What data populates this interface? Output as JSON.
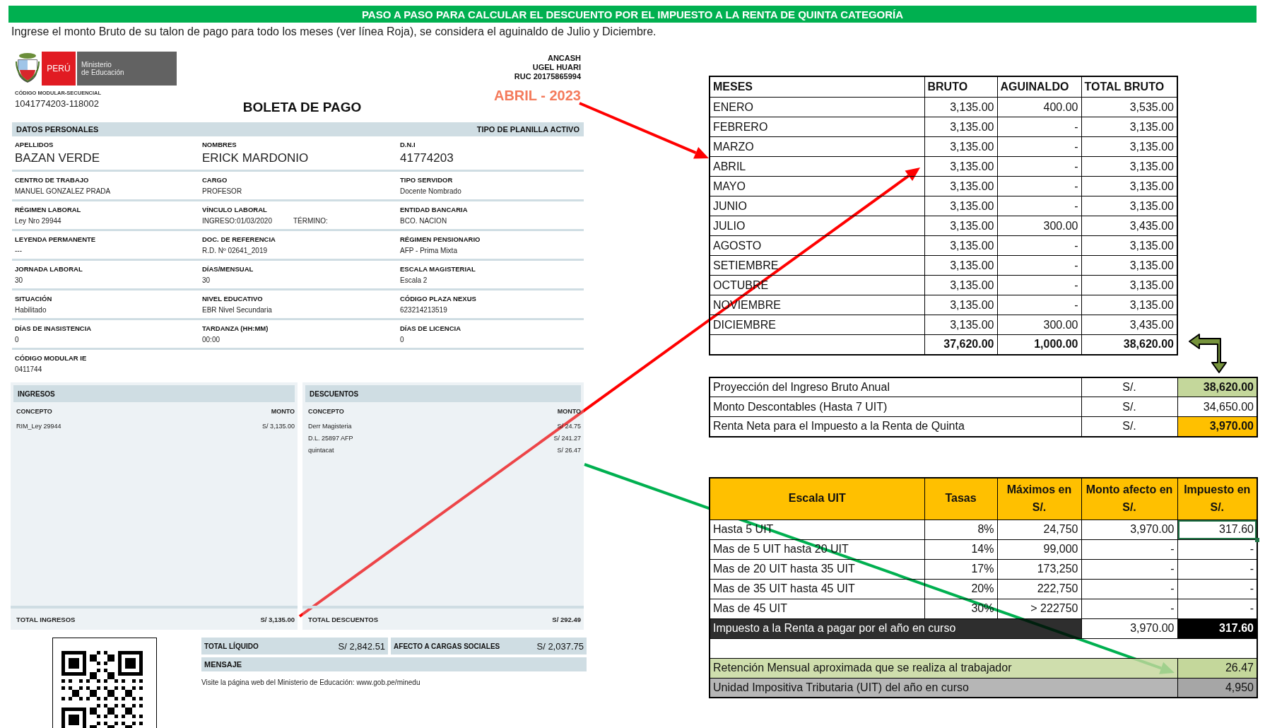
{
  "banner": "PASO A PASO PARA CALCULAR EL DESCUENTO POR EL IMPUESTO A LA RENTA DE QUINTA CATEGORÍA",
  "instruction": "Ingrese el monto Bruto de su talon de pago para todo los meses (ver línea Roja), se considera el aguinaldo de Julio y Diciembre.",
  "payslip": {
    "logo": {
      "country": "PERÚ",
      "ministry": [
        "Ministerio",
        "de Educación"
      ]
    },
    "code_label": "CÓDIGO MODULAR-SECUENCIAL",
    "code": "1041774203-118002",
    "title": "BOLETA DE PAGO",
    "issuer": [
      "ANCASH",
      "UGEL HUARI",
      "RUC 20175865994"
    ],
    "period": "ABRIL - 2023",
    "section": {
      "title": "DATOS PERSONALES",
      "right": "TIPO DE PLANILLA  ACTIVO"
    },
    "field_rows": [
      {
        "kind": "large",
        "fields": [
          {
            "label": "APELLIDOS",
            "value": "BAZAN VERDE"
          },
          {
            "label": "NOMBRES",
            "value": "ERICK MARDONIO"
          },
          {
            "label": "D.N.I",
            "value": "41774203"
          }
        ]
      },
      {
        "kind": "normal",
        "fields": [
          {
            "label": "CENTRO DE TRABAJO",
            "value": "MANUEL GONZALEZ PRADA"
          },
          {
            "label": "CARGO",
            "value": "PROFESOR"
          },
          {
            "label": "TIPO SERVIDOR",
            "value": "Docente Nombrado"
          }
        ]
      },
      {
        "kind": "normal",
        "fields": [
          {
            "label": "RÉGIMEN LABORAL",
            "value": "Ley Nro 29944"
          },
          {
            "label": "VÍNCULO LABORAL",
            "value": "INGRESO:01/03/2020",
            "extra": "TÉRMINO:"
          },
          {
            "label": "ENTIDAD BANCARIA",
            "value": "BCO. NACION"
          }
        ]
      },
      {
        "kind": "normal",
        "fields": [
          {
            "label": "LEYENDA PERMANENTE",
            "value": "---"
          },
          {
            "label": "DOC. DE REFERENCIA",
            "value": "R.D. Nº 02641_2019"
          },
          {
            "label": "RÉGIMEN PENSIONARIO",
            "value": "AFP - Prima Mixta"
          }
        ]
      },
      {
        "kind": "normal",
        "fields": [
          {
            "label": "JORNADA LABORAL",
            "value": "30"
          },
          {
            "label": "DÍAS/MENSUAL",
            "value": "30"
          },
          {
            "label": "ESCALA MAGISTERIAL",
            "value": "Escala 2"
          }
        ]
      },
      {
        "kind": "normal",
        "fields": [
          {
            "label": "SITUACIÓN",
            "value": "Habilitado"
          },
          {
            "label": "NIVEL EDUCATIVO",
            "value": "EBR Nivel Secundaria"
          },
          {
            "label": "CÓDIGO PLAZA NEXUS",
            "value": "623214213519"
          }
        ]
      },
      {
        "kind": "normal",
        "fields": [
          {
            "label": "DÍAS DE INASISTENCIA",
            "value": "0"
          },
          {
            "label": "TARDANZA  (HH:MM)",
            "value": "00:00"
          },
          {
            "label": "DÍAS DE LICENCIA",
            "value": "0"
          }
        ]
      },
      {
        "kind": "last",
        "fields": [
          {
            "label": "CÓDIGO MODULAR IE",
            "value": "0411744"
          }
        ]
      }
    ],
    "income": {
      "title": "INGRESOS",
      "columns": [
        "CONCEPTO",
        "MONTO"
      ],
      "rows": [
        [
          "RIM_Ley 29944",
          "S/ 3,135.00"
        ]
      ],
      "total_label": "TOTAL INGRESOS",
      "total": "S/ 3,135.00"
    },
    "deductions": {
      "title": "DESCUENTOS",
      "columns": [
        "CONCEPTO",
        "MONTO"
      ],
      "rows": [
        [
          "Derr Magisteria",
          "S/ 24.75"
        ],
        [
          "D.L. 25897 AFP",
          "S/ 241.27"
        ],
        [
          "quintacat",
          "S/ 26.47"
        ]
      ],
      "total_label": "TOTAL DESCUENTOS",
      "total": "S/ 292.49"
    },
    "summary": [
      {
        "label": "TOTAL LÍQUIDO",
        "value": "S/ 2,842.51"
      },
      {
        "label": "AFECTO A CARGAS SOCIALES",
        "value": "S/ 2,037.75"
      }
    ],
    "message": {
      "title": "MENSAJE",
      "text": "Visite la página web del Ministerio de Educación: www.gob.pe/minedu"
    }
  },
  "months_table": {
    "columns": [
      "MESES",
      "BRUTO",
      "AGUINALDO",
      "TOTAL BRUTO"
    ],
    "rows": [
      [
        "ENERO",
        "3,135.00",
        "400.00",
        "3,535.00"
      ],
      [
        "FEBRERO",
        "3,135.00",
        "-",
        "3,135.00"
      ],
      [
        "MARZO",
        "3,135.00",
        "-",
        "3,135.00"
      ],
      [
        "ABRIL",
        "3,135.00",
        "-",
        "3,135.00"
      ],
      [
        "MAYO",
        "3,135.00",
        "-",
        "3,135.00"
      ],
      [
        "JUNIO",
        "3,135.00",
        "-",
        "3,135.00"
      ],
      [
        "JULIO",
        "3,135.00",
        "300.00",
        "3,435.00"
      ],
      [
        "AGOSTO",
        "3,135.00",
        "-",
        "3,135.00"
      ],
      [
        "SETIEMBRE",
        "3,135.00",
        "-",
        "3,135.00"
      ],
      [
        "OCTUBRE",
        "3,135.00",
        "-",
        "3,135.00"
      ],
      [
        "NOVIEMBRE",
        "3,135.00",
        "-",
        "3,135.00"
      ],
      [
        "DICIEMBRE",
        "3,135.00",
        "300.00",
        "3,435.00"
      ]
    ],
    "totals": [
      "37,620.00",
      "1,000.00",
      "38,620.00"
    ]
  },
  "projection": {
    "rows": [
      {
        "label": "Proyección del Ingreso Bruto Anual",
        "currency": "S/.",
        "value": "38,620.00",
        "color": "#c4d79b",
        "emphasis": true
      },
      {
        "label": "Monto Descontables (Hasta 7 UIT)",
        "currency": "S/.",
        "value": "34,650.00",
        "color": "#ffffff",
        "emphasis": false
      },
      {
        "label": "Renta Neta para el Impuesto a la Renta de Quinta",
        "currency": "S/.",
        "value": "3,970.00",
        "color": "#ffc000",
        "emphasis": true
      }
    ]
  },
  "tax_table": {
    "columns": [
      "Escala UIT",
      "Tasas",
      "Máximos en S/.",
      "Monto afecto en S/.",
      "Impuesto en S/."
    ],
    "rows": [
      {
        "scale": "Hasta 5 UIT",
        "rate": "8%",
        "max": "24,750",
        "amount": "3,970.00",
        "tax": "317.60",
        "tax_selected": true
      },
      {
        "scale": "Mas de 5 UIT hasta 20 UIT",
        "rate": "14%",
        "max": "99,000",
        "amount": "-",
        "tax": "-",
        "tax_selected": false
      },
      {
        "scale": "Mas de 20 UIT hasta 35 UIT",
        "rate": "17%",
        "max": "173,250",
        "amount": "-",
        "tax": "-",
        "tax_selected": false
      },
      {
        "scale": "Mas de 35 UIT hasta 45 UIT",
        "rate": "20%",
        "max": "222,750",
        "amount": "-",
        "tax": "-",
        "tax_selected": false
      },
      {
        "scale": "Mas de 45 UIT",
        "rate": "30%",
        "max": "> 222750",
        "amount": "-",
        "tax": "-",
        "tax_selected": false
      }
    ],
    "total": {
      "label": "Impuesto a la Renta a pagar por el año en curso",
      "amount": "3,970.00",
      "tax": "317.60"
    },
    "footer_rows": [
      {
        "label": "Retención Mensual aproximada que se realiza al trabajador",
        "value": "26.47",
        "color": "#c4d79b"
      },
      {
        "label": "Unidad Impositiva Tributaria (UIT) del año en curso",
        "value": "4,950",
        "color": "#a6a6a6"
      }
    ]
  }
}
